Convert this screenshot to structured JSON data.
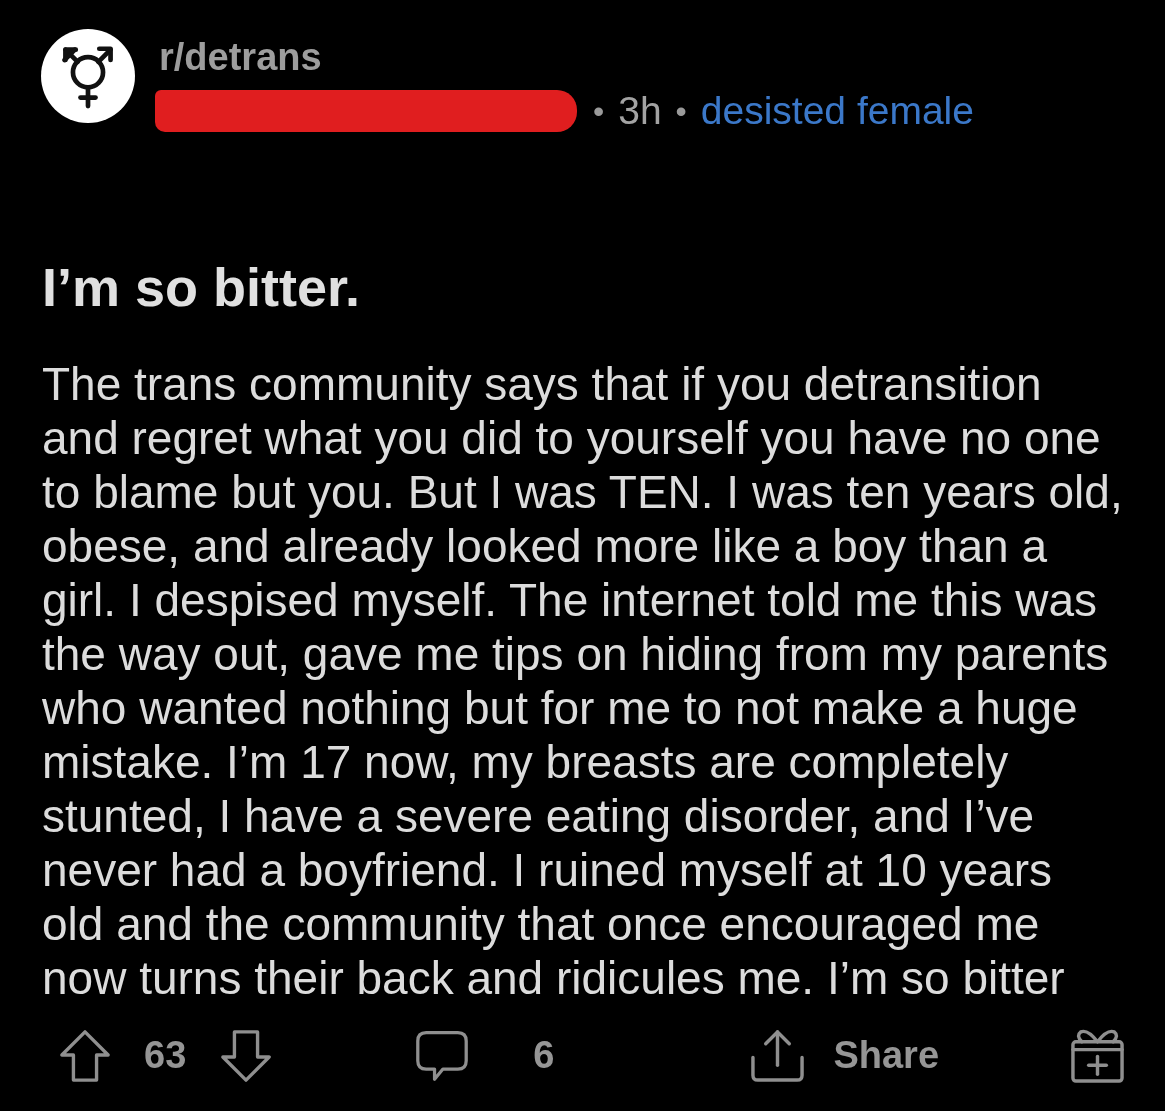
{
  "post": {
    "subreddit": "r/detrans",
    "meta": [
      {
        "kind": "separator",
        "text": "•"
      },
      {
        "kind": "time",
        "text": "3h"
      },
      {
        "kind": "separator",
        "text": "•"
      },
      {
        "kind": "flair",
        "text": "desisted female"
      }
    ],
    "title": "I’m so bitter.",
    "body": "The trans community says that if you detransition and regret what you did to yourself you have no one to blame but you. But I was TEN. I was ten years old, obese, and already looked more like a boy than a girl. I despised myself. The internet told me this was the way out, gave me tips on hiding from my parents who wanted nothing but for me to not make a huge mistake. I’m 17 now, my breasts are completely stunted, I have a severe eating disorder, and I’ve never had a boyfriend. I ruined myself at 10 years old and the community that once encouraged me now turns their back and ridicules me. I’m so bitter"
  },
  "actions": {
    "score": "63",
    "comments": "6",
    "share": "Share"
  }
}
